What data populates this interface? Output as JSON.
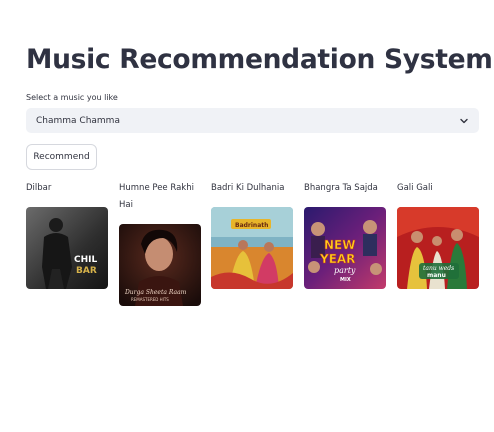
{
  "app": {
    "title": "Music Recommendation System"
  },
  "selector": {
    "label": "Select a music you like",
    "value": "Chamma Chamma"
  },
  "button": {
    "label": "Recommend"
  },
  "recommendations": [
    {
      "title": "Dilbar",
      "poster_text": "CHIL BAR"
    },
    {
      "title": "Humne Pee Rakhi Hai",
      "poster_text": "Durga Sheeta Raam",
      "poster_subtext": "REMASTERED HITS"
    },
    {
      "title": "Badri Ki Dulhania",
      "poster_text": "Badrinath"
    },
    {
      "title": "Bhangra Ta Sajda",
      "poster_text": "NEW YEAR",
      "poster_subtext": "party MIX"
    },
    {
      "title": "Gali Gali",
      "poster_text": "tanu weds manu"
    }
  ]
}
